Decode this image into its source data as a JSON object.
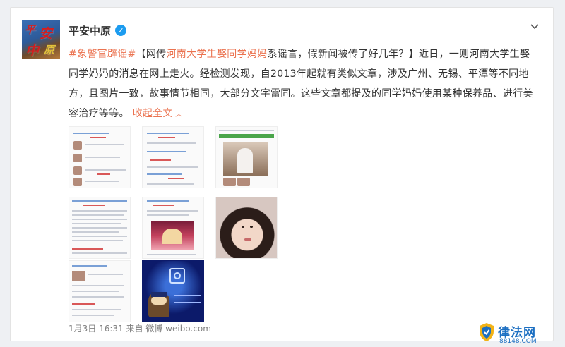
{
  "post": {
    "user_name": "平安中原",
    "verified_icon": "verified-badge-icon",
    "text_topic": "#象警官辟谣#",
    "text_open": "【网传",
    "text_highlight": "河南大学生娶同学妈妈",
    "text_mid": "系谣言，假新闻被传了好几年？】近日，一则河南大学生娶同学妈妈的消息在网上走火。经检测发现，自2013年起就有类似文章，涉及广州、无锡、平潭等不同地方，且图片一致，故事情节相同，大部分文字雷同。这些文章都提及的同学妈妈使用某种保养品、进行美容治疗等等。",
    "collapse_label": "收起全文",
    "avatar_glyphs": [
      "平",
      "安",
      "中",
      "原"
    ]
  },
  "footer": {
    "time": "1月3日 16:31",
    "source_prefix": "来自",
    "source": "微博 weibo.com"
  },
  "watermark": {
    "title": "律法网",
    "url": "88148.COM"
  },
  "colors": {
    "accent": "#eb7350",
    "verified": "#1c9cf0",
    "watermark": "#1c6fc2"
  }
}
